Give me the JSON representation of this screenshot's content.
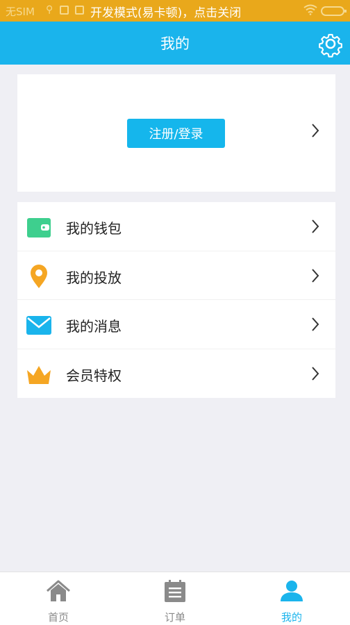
{
  "status_bar": {
    "carrier": "无SIM",
    "notice": "开发模式(易卡顿)，点击关闭"
  },
  "header": {
    "title": "我的",
    "settings_icon": "gear-icon"
  },
  "login": {
    "button_label": "注册/登录"
  },
  "menu": {
    "items": [
      {
        "label": "我的钱包",
        "icon": "wallet-icon",
        "color": "#3ecf8e"
      },
      {
        "label": "我的投放",
        "icon": "location-pin-icon",
        "color": "#f5a623"
      },
      {
        "label": "我的消息",
        "icon": "envelope-icon",
        "color": "#1ab4ec"
      },
      {
        "label": "会员特权",
        "icon": "crown-icon",
        "color": "#f5a623"
      }
    ]
  },
  "tabbar": {
    "tabs": [
      {
        "label": "首页",
        "icon": "home-icon",
        "active": false
      },
      {
        "label": "订单",
        "icon": "clipboard-icon",
        "active": false
      },
      {
        "label": "我的",
        "icon": "user-icon",
        "active": true
      }
    ]
  },
  "colors": {
    "accent": "#1ab4ec",
    "status_bar": "#e9a81b",
    "background": "#efeff4"
  }
}
